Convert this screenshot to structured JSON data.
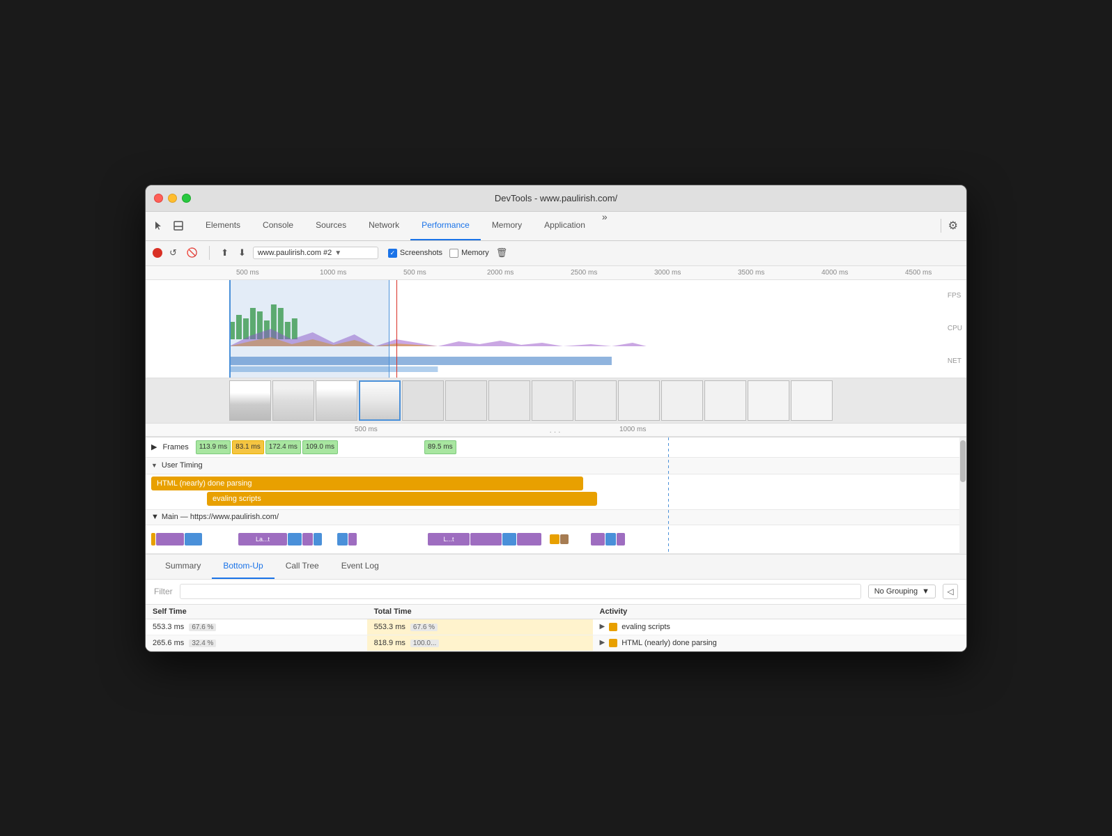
{
  "window": {
    "title": "DevTools - www.paulirish.com/"
  },
  "titlebar": {
    "title": "DevTools - www.paulirish.com/"
  },
  "toolbar": {
    "tabs": [
      {
        "label": "Elements",
        "active": false
      },
      {
        "label": "Console",
        "active": false
      },
      {
        "label": "Sources",
        "active": false
      },
      {
        "label": "Network",
        "active": false
      },
      {
        "label": "Performance",
        "active": true
      },
      {
        "label": "Memory",
        "active": false
      },
      {
        "label": "Application",
        "active": false
      }
    ],
    "more_label": "»",
    "menu_label": "⋮"
  },
  "recordbar": {
    "url_value": "www.paulirish.com #2",
    "screenshots_label": "Screenshots",
    "memory_label": "Memory",
    "screenshots_checked": true,
    "memory_checked": false
  },
  "ruler": {
    "marks": [
      "500 ms",
      "1000 ms",
      "500 ms",
      "2000 ms",
      "2500 ms",
      "3000 ms",
      "3500 ms",
      "4000 ms",
      "4500 ms"
    ]
  },
  "side_labels": {
    "fps": "FPS",
    "cpu": "CPU",
    "net": "NET"
  },
  "bottom_ruler": {
    "dots": "...",
    "mark1": "500 ms",
    "mark2": "1000 ms"
  },
  "frames": {
    "header": "Frames",
    "values": [
      "113.9 ms",
      "83.1 ms",
      "172.4 ms",
      "109.0 ms",
      "89.5 ms"
    ]
  },
  "user_timing": {
    "header": "User Timing",
    "bars": [
      {
        "label": "HTML (nearly) done parsing",
        "color": "orange"
      },
      {
        "label": "evaling scripts",
        "color": "orange"
      }
    ]
  },
  "main_thread": {
    "header": "Main — https://www.paulirish.com/",
    "la_label": "La...t",
    "l_label": "L...t"
  },
  "bottom_panel": {
    "tabs": [
      {
        "label": "Summary",
        "active": false
      },
      {
        "label": "Bottom-Up",
        "active": true
      },
      {
        "label": "Call Tree",
        "active": false
      },
      {
        "label": "Event Log",
        "active": false
      }
    ]
  },
  "filter": {
    "label": "Filter",
    "grouping_label": "No Grouping",
    "collapse_icon": "◁"
  },
  "table": {
    "headers": [
      "Self Time",
      "Total Time",
      "Activity"
    ],
    "rows": [
      {
        "self_time": "553.3 ms",
        "self_pct": "67.6 %",
        "total_time": "553.3 ms",
        "total_pct": "67.6 %",
        "activity_icon": "orange",
        "activity_label": "evaling scripts"
      },
      {
        "self_time": "265.6 ms",
        "self_pct": "32.4 %",
        "total_time": "818.9 ms",
        "total_pct": "100.0...",
        "activity_icon": "orange",
        "activity_label": "HTML (nearly) done parsing"
      }
    ]
  }
}
